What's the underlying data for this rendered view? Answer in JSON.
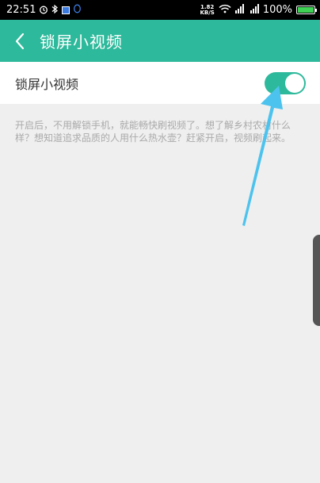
{
  "status_bar": {
    "time": "22:51",
    "net_speed_value": "1.82",
    "net_speed_unit": "KB/S",
    "battery_percent": "100%",
    "battery_level": 1.0,
    "icons": [
      "alarm-icon",
      "bluetooth-icon",
      "notification-icon",
      "qq-icon",
      "wifi-icon",
      "signal-icon",
      "signal-4g-icon",
      "battery-icon"
    ]
  },
  "header": {
    "title": "锁屏小视频",
    "back_icon": "chevron-left-icon"
  },
  "setting": {
    "label": "锁屏小视频",
    "enabled": true
  },
  "description": "开启后，不用解锁手机，就能畅快刷视频了。想了解乡村农村什么样？想知道追求品质的人用什么热水壶？赶紧开启，视频刷起来。",
  "colors": {
    "accent": "#2db99b",
    "annotation_arrow": "#4cc3ee",
    "background": "#efefef"
  }
}
